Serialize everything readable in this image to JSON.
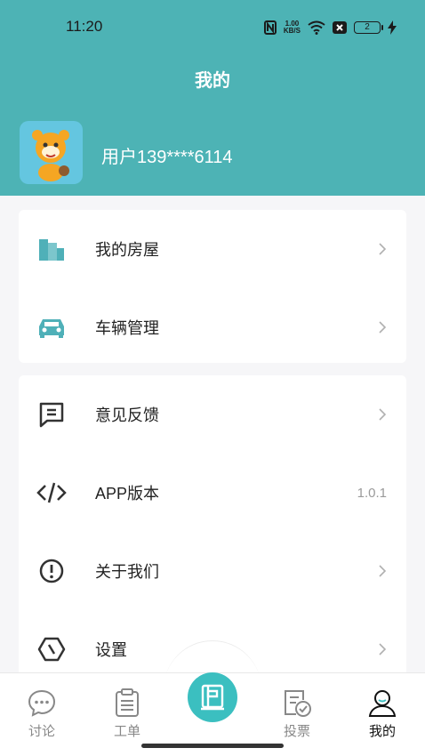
{
  "status_bar": {
    "time": "11:20",
    "net_speed_value": "1.00",
    "net_speed_unit": "KB/S",
    "battery_level": "2"
  },
  "header": {
    "title": "我的",
    "user_name": "用户139****6114"
  },
  "menu_group_1": [
    {
      "label": "我的房屋",
      "icon": "building-icon"
    },
    {
      "label": "车辆管理",
      "icon": "car-icon"
    }
  ],
  "menu_group_2": [
    {
      "label": "意见反馈",
      "icon": "feedback-icon"
    },
    {
      "label": "APP版本",
      "icon": "code-icon",
      "value": "1.0.1"
    },
    {
      "label": "关于我们",
      "icon": "info-icon"
    },
    {
      "label": "设置",
      "icon": "settings-icon"
    }
  ],
  "tabbar": [
    {
      "label": "讨论",
      "icon": "chat-bubble-icon",
      "active": false
    },
    {
      "label": "工单",
      "icon": "clipboard-icon",
      "active": false
    },
    {
      "label": "",
      "icon": "center-action-icon",
      "active": false
    },
    {
      "label": "投票",
      "icon": "vote-icon",
      "active": false
    },
    {
      "label": "我的",
      "icon": "person-icon",
      "active": true
    }
  ],
  "colors": {
    "header_bg": "#4db3b5",
    "accent": "#3bbfc0",
    "icon_teal": "#4fb0b8",
    "icon_dark": "#333333"
  }
}
